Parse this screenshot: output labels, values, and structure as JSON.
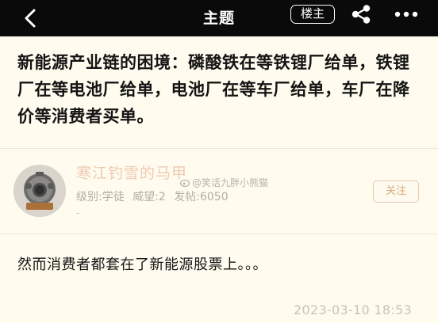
{
  "header": {
    "title": "主题",
    "op_badge": "楼主",
    "icons": {
      "back": "chevron-left-icon",
      "share": "share-icon",
      "more": "more-horizontal-icon"
    }
  },
  "post": {
    "title": "新能源产业链的困境：磷酸铁在等铁锂厂给单，铁锂厂在等电池厂给单，电池厂在等车厂给单，车厂在降价等消费者买单。",
    "author": {
      "name": "寒江钓雪的马甲",
      "level_label": "级别:学徒",
      "prestige_label": "威望:2",
      "posts_label": "发帖:6050",
      "extra": "-",
      "follow_label": "关注",
      "watermark": "@笑话九胖小熊猫"
    },
    "content": "然而消费者都套在了新能源股票上。。。",
    "timestamp": "2023-03-10 18:53"
  },
  "colors": {
    "header_bg": "#0a0a0a",
    "page_bg": "#fffcef",
    "username": "#f0c9b2",
    "follow": "#d7a977"
  }
}
